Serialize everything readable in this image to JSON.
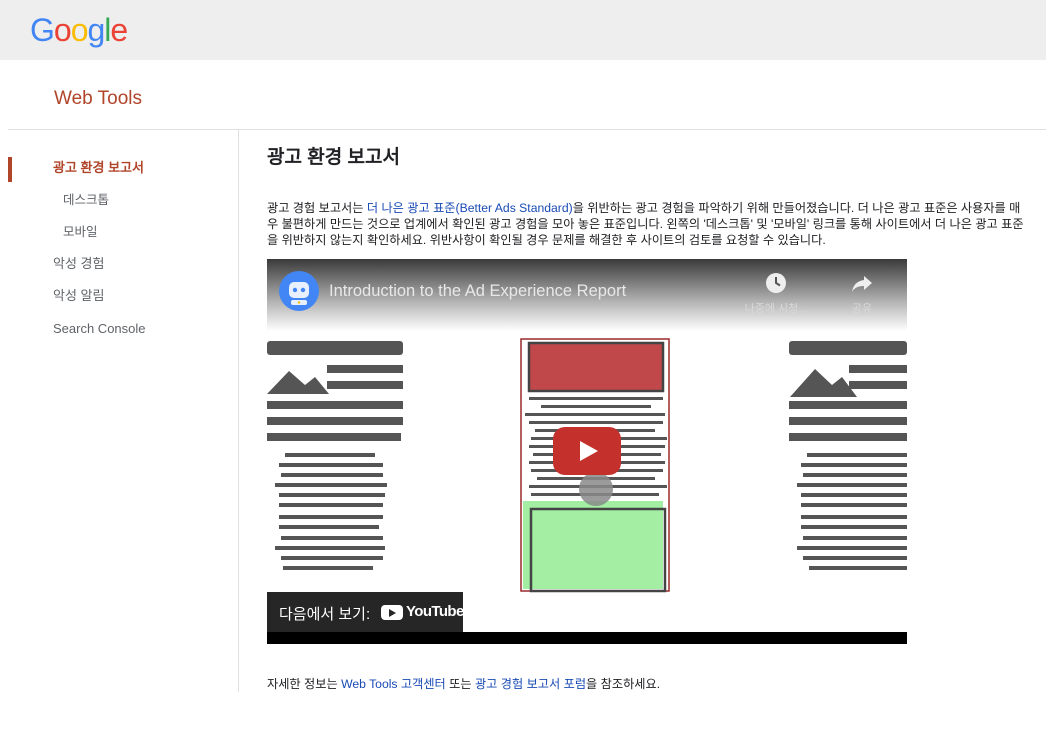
{
  "brand": {
    "logo_letters": [
      {
        "char": "G",
        "color": "#4285F4"
      },
      {
        "char": "o",
        "color": "#EA4335"
      },
      {
        "char": "o",
        "color": "#FBBC05"
      },
      {
        "char": "g",
        "color": "#4285F4"
      },
      {
        "char": "l",
        "color": "#34A853"
      },
      {
        "char": "e",
        "color": "#EA4335"
      }
    ],
    "product_title": "Web Tools",
    "accent_color": "#B0452A",
    "link_color": "#1A4BB5"
  },
  "sidebar": {
    "items": [
      {
        "label": "광고 환경 보고서",
        "active": true
      },
      {
        "label": "데스크톱",
        "sub": true
      },
      {
        "label": "모바일",
        "sub": true
      },
      {
        "label": "악성 경험"
      },
      {
        "label": "악성 알림"
      },
      {
        "label": "Search Console"
      }
    ]
  },
  "main": {
    "title": "광고 환경 보고서",
    "intro": {
      "before_link": "광고 경험 보고서는 ",
      "link_text": "더 나은 광고 표준(Better Ads Standard)",
      "after_link": "을 위반하는 광고 경험을 파악하기 위해 만들어졌습니다. 더 나은 광고 표준은 사용자를 매우 불편하게 만드는 것으로 업계에서 확인된 광고 경험을 모아 놓은 표준입니다. 왼쪽의 '데스크톱' 및 '모바일' 링크를 통해 사이트에서 더 나은 광고 표준을 위반하지 않는지 확인하세요. 위반사항이 확인될 경우 문제를 해결한 후 사이트의 검토를 요청할 수 있습니다."
    },
    "video": {
      "title": "Introduction to the Ad Experience Report",
      "watch_later_label": "나중에 시청...",
      "share_label": "공유",
      "watch_on_label": "다음에서 보기:",
      "youtube_logo_text": "YouTube",
      "play_button_color": "#C4302B"
    },
    "footer": {
      "prefix": "자세한 정보는 ",
      "link1": "Web Tools 고객센터",
      "middle": " 또는 ",
      "link2": "광고 경험 보고서 포럼",
      "suffix": "을 참조하세요."
    }
  }
}
